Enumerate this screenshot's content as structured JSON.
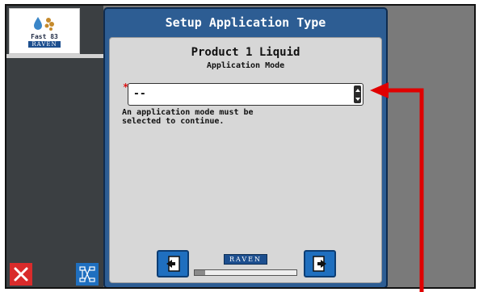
{
  "logo": {
    "text": "Fast 83",
    "brand": "RAVEN"
  },
  "dialog": {
    "title": "Setup Application Type",
    "product": "Product 1 Liquid",
    "field_label": "Application Mode",
    "required_marker": "*",
    "select_value": "--",
    "message": "An application mode must be\nselected to continue."
  },
  "footer": {
    "brand": "RAVEN",
    "progress": 0.1
  },
  "icons": {
    "close": "close-icon",
    "diagram": "diagram-icon",
    "back": "back-arrow-icon",
    "next": "next-arrow-icon"
  },
  "colors": {
    "dialog_header": "#2d5d93",
    "button": "#1f6fbf",
    "close_button": "#d92b2b",
    "annotation_arrow": "#e00000"
  }
}
